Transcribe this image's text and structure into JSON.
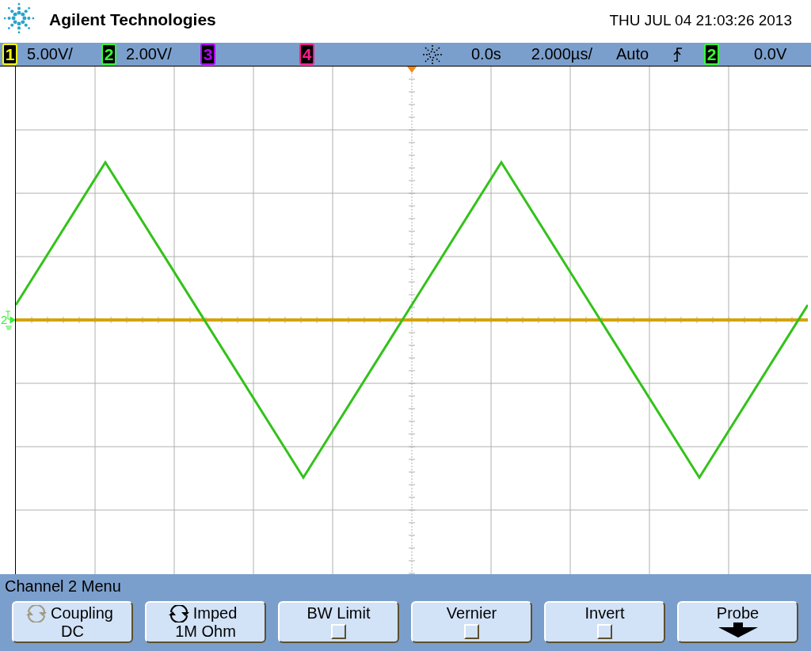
{
  "header": {
    "brand": "Agilent Technologies",
    "datetime": "THU JUL 04 21:03:26 2013"
  },
  "status_bar": {
    "channels": [
      {
        "number": "1",
        "color": "#ffff00",
        "scale": "5.00V/"
      },
      {
        "number": "2",
        "color": "#33ff33",
        "scale": "2.00V/"
      },
      {
        "number": "3",
        "color": "#b000ff"
      },
      {
        "number": "4",
        "color": "#ff1a8c"
      }
    ],
    "delay": "0.0s",
    "timebase": "2.000µs/",
    "trigger_mode": "Auto",
    "trigger_source": {
      "number": "2",
      "color": "#33ff33"
    },
    "trigger_level": "0.0V"
  },
  "display": {
    "ground_marker": {
      "number": "2"
    }
  },
  "menu": {
    "title": "Channel 2  Menu",
    "softkeys": [
      {
        "kind": "cycle",
        "label": "Coupling",
        "value": "DC",
        "active": false
      },
      {
        "kind": "cycle",
        "label": "Imped",
        "value": "1M Ohm",
        "active": true
      },
      {
        "kind": "checkbox",
        "label": "BW Limit",
        "checked": false
      },
      {
        "kind": "checkbox",
        "label": "Vernier",
        "checked": false
      },
      {
        "kind": "checkbox",
        "label": "Invert",
        "checked": false
      },
      {
        "kind": "submenu",
        "label": "Probe"
      }
    ]
  }
}
